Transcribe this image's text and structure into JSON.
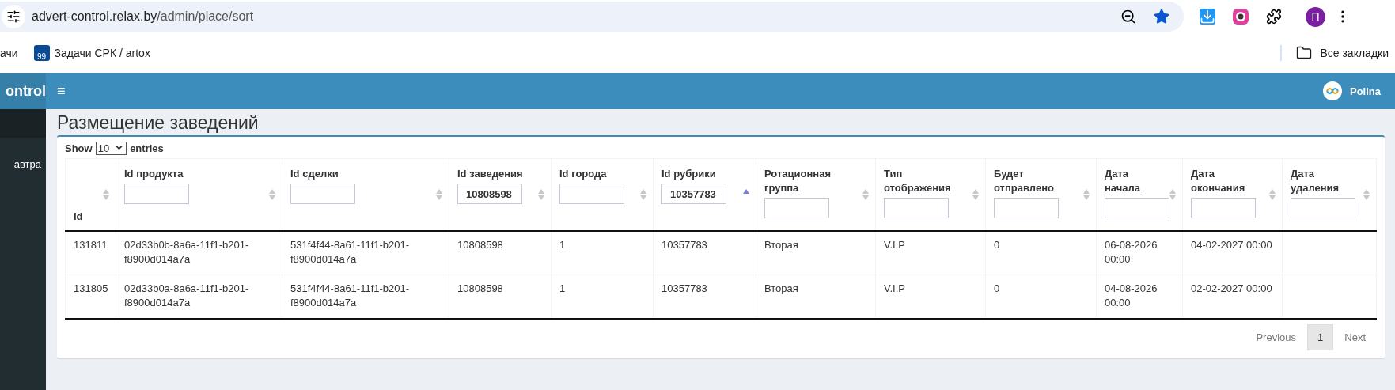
{
  "browser": {
    "url_host": "advert-control.relax.by",
    "url_path": "/admin/place/sort",
    "profile_initial": "П"
  },
  "bookmarks": {
    "items": [
      {
        "label": "ачи",
        "kind": "plain"
      },
      {
        "label": "Задачи СРК / artox",
        "kind": "badge",
        "badge": "99"
      }
    ],
    "all_bookmarks": "Все закладки"
  },
  "header": {
    "brand": "ontrol",
    "menu_icon": "≡",
    "user": "Polina"
  },
  "sidebar": {
    "items": [
      {
        "label": "автра"
      }
    ]
  },
  "page": {
    "title": "Размещение заведений"
  },
  "length_menu": {
    "prefix": "Show",
    "value": "10",
    "suffix": "entries"
  },
  "table": {
    "columns": [
      {
        "label": "Id",
        "kind": "plain",
        "sorted": false
      },
      {
        "label": "Id продукта",
        "kind": "filter",
        "sorted": false
      },
      {
        "label": "Id сделки",
        "kind": "filter",
        "sorted": false
      },
      {
        "label": "Id заведения",
        "kind": "filter",
        "sorted": false,
        "value": "10808598"
      },
      {
        "label": "Id города",
        "kind": "filter",
        "sorted": false
      },
      {
        "label": "Id рубрики",
        "kind": "filter",
        "sorted": true,
        "value": "10357783"
      },
      {
        "label": "Ротационная\nгруппа",
        "kind": "filter",
        "sorted": false
      },
      {
        "label": "Тип\nотображения",
        "kind": "filter",
        "sorted": false
      },
      {
        "label": "Будет\nотправлено",
        "kind": "filter",
        "sorted": false
      },
      {
        "label": "Дата\nначала",
        "kind": "filter",
        "sorted": false
      },
      {
        "label": "Дата\nокончания",
        "kind": "filter",
        "sorted": false
      },
      {
        "label": "Дата\nудаления",
        "kind": "filter",
        "sorted": false
      }
    ],
    "rows": [
      [
        "131811",
        "02d33b0b-8a6a-11f1-b201-f8900d014a7a",
        "531f4f44-8a61-11f1-b201-f8900d014a7a",
        "10808598",
        "1",
        "10357783",
        "Вторая",
        "V.I.P",
        "0",
        "06-08-2026 00:00",
        "04-02-2027 00:00"
      ],
      [
        "131805",
        "02d33b0a-8a6a-11f1-b201-f8900d014a7a",
        "531f4f44-8a61-11f1-b201-f8900d014a7a",
        "10808598",
        "1",
        "10357783",
        "Вторая",
        "V.I.P",
        "0",
        "04-08-2026 00:00",
        "02-02-2027 00:00"
      ]
    ]
  },
  "pagination": {
    "previous": "Previous",
    "pages": [
      {
        "label": "1",
        "selected": true
      }
    ],
    "next": "Next"
  }
}
